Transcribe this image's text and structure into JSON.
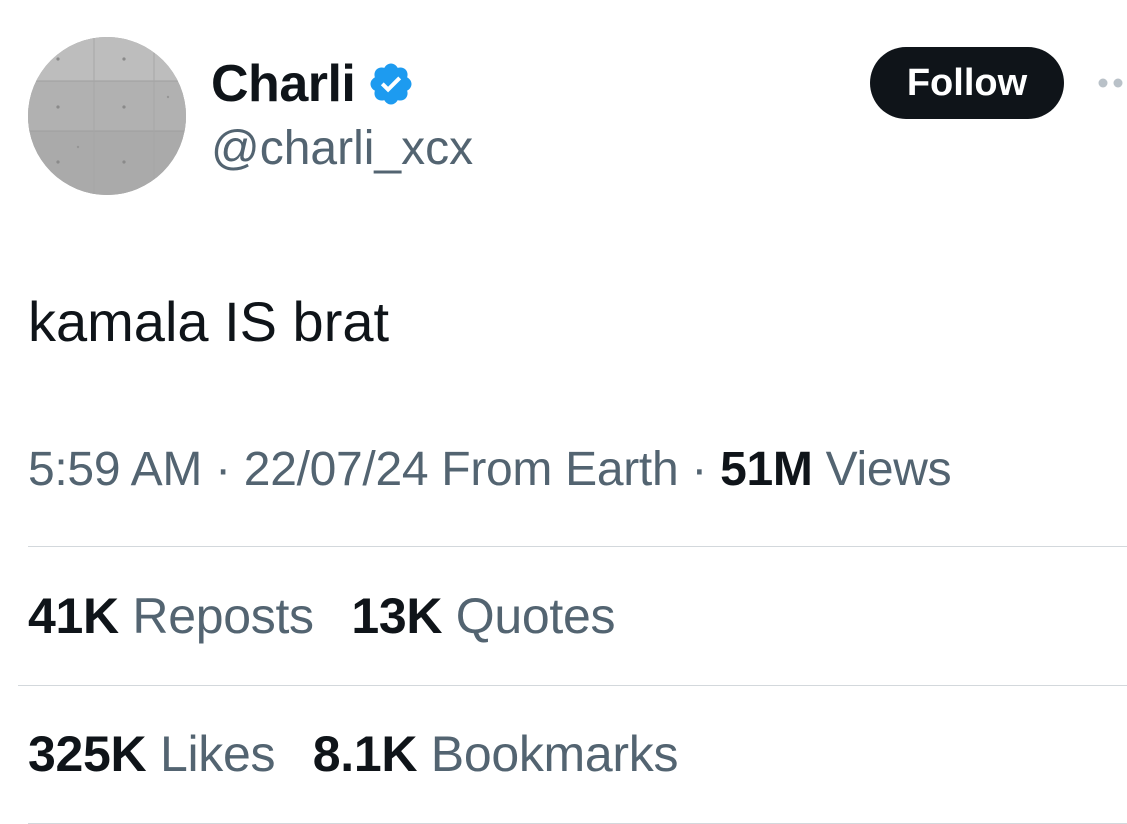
{
  "author": {
    "display_name": "Charli",
    "handle": "@charli_xcx",
    "verified_icon": "verified-badge-icon",
    "avatar": "concrete-wall-avatar"
  },
  "follow_label": "Follow",
  "more_icon": "more-options-icon",
  "tweet": {
    "text": "kamala IS brat"
  },
  "meta": {
    "time": "5:59 AM",
    "separator_1": "·",
    "date": "22/07/24",
    "source": "From Earth",
    "separator_2": "·",
    "views_count": "51M",
    "views_label": "Views"
  },
  "stats": {
    "reposts_count": "41K",
    "reposts_label": "Reposts",
    "quotes_count": "13K",
    "quotes_label": "Quotes",
    "likes_count": "325K",
    "likes_label": "Likes",
    "bookmarks_count": "8.1K",
    "bookmarks_label": "Bookmarks"
  },
  "colors": {
    "text_primary": "#0f1419",
    "text_secondary": "#536471",
    "verified_blue": "#1d9bf0",
    "divider": "#d3d8dc",
    "button_bg": "#0f1419"
  }
}
